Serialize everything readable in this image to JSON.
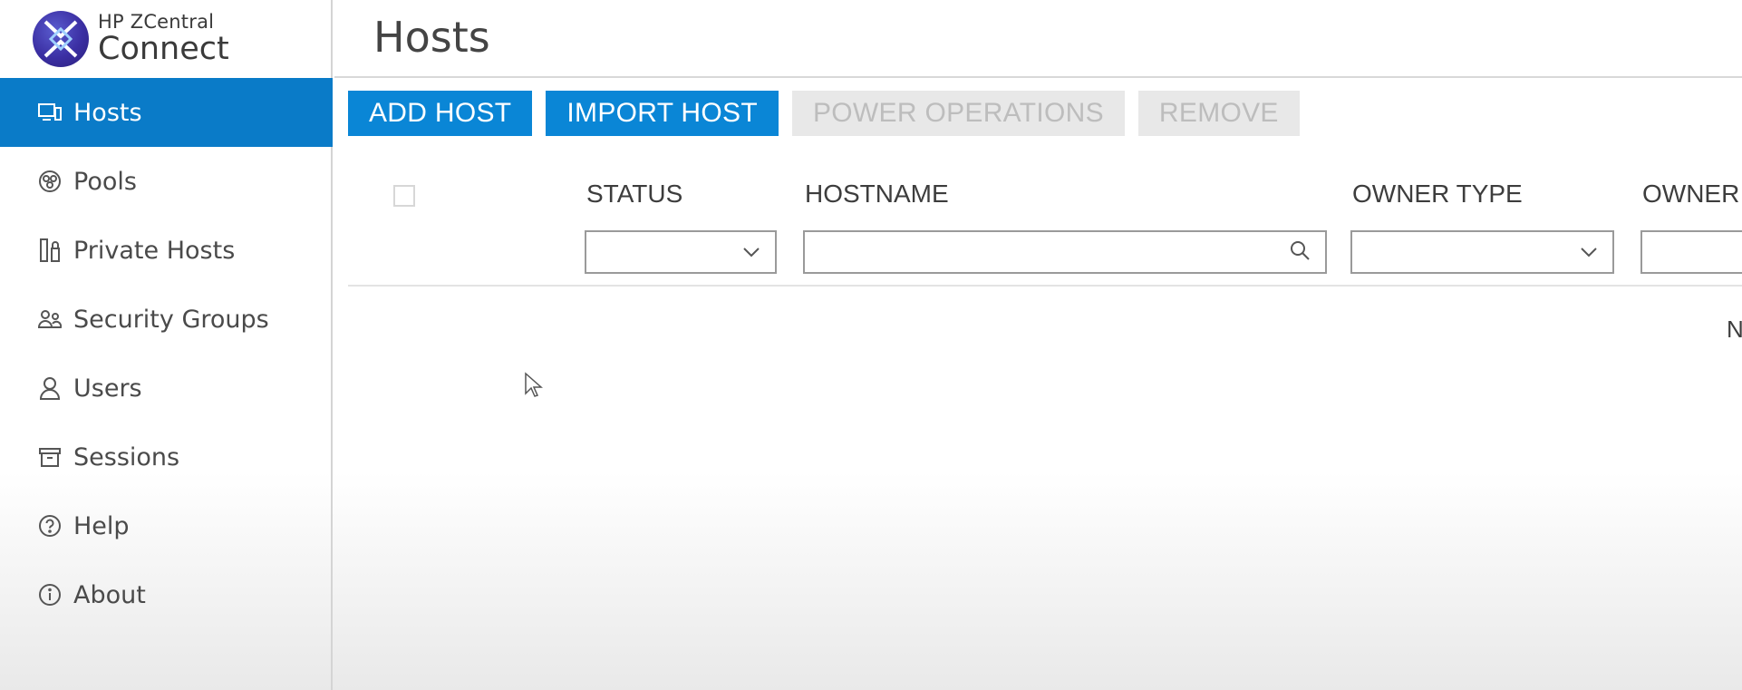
{
  "brand": {
    "subtitle": "HP ZCentral",
    "title": "Connect",
    "logo_icon": "hp-zcentral-logo-icon",
    "logo_color": "#3b2fa3"
  },
  "sidebar": {
    "accent_color": "#0a7bc8",
    "items": [
      {
        "label": "Hosts",
        "icon": "monitor-icon",
        "active": true
      },
      {
        "label": "Pools",
        "icon": "pools-icon",
        "active": false
      },
      {
        "label": "Private Hosts",
        "icon": "private-hosts-icon",
        "active": false
      },
      {
        "label": "Security Groups",
        "icon": "people-icon",
        "active": false
      },
      {
        "label": "Users",
        "icon": "user-icon",
        "active": false
      },
      {
        "label": "Sessions",
        "icon": "archive-box-icon",
        "active": false
      },
      {
        "label": "Help",
        "icon": "help-circle-icon",
        "active": false
      },
      {
        "label": "About",
        "icon": "info-circle-icon",
        "active": false
      }
    ]
  },
  "main": {
    "page_title": "Hosts",
    "toolbar": {
      "add_host": "ADD HOST",
      "import_host": "IMPORT HOST",
      "power_operations": "POWER OPERATIONS",
      "remove": "REMOVE",
      "primary_color": "#0a86d6",
      "disabled_color": "#e8e8e8"
    },
    "table": {
      "columns": [
        {
          "label": "STATUS",
          "filter": "dropdown",
          "value": ""
        },
        {
          "label": "HOSTNAME",
          "filter": "search",
          "value": ""
        },
        {
          "label": "OWNER TYPE",
          "filter": "dropdown",
          "value": ""
        },
        {
          "label": "OWNER N",
          "filter": "text",
          "value": ""
        }
      ],
      "empty_text_partial": "N"
    }
  }
}
